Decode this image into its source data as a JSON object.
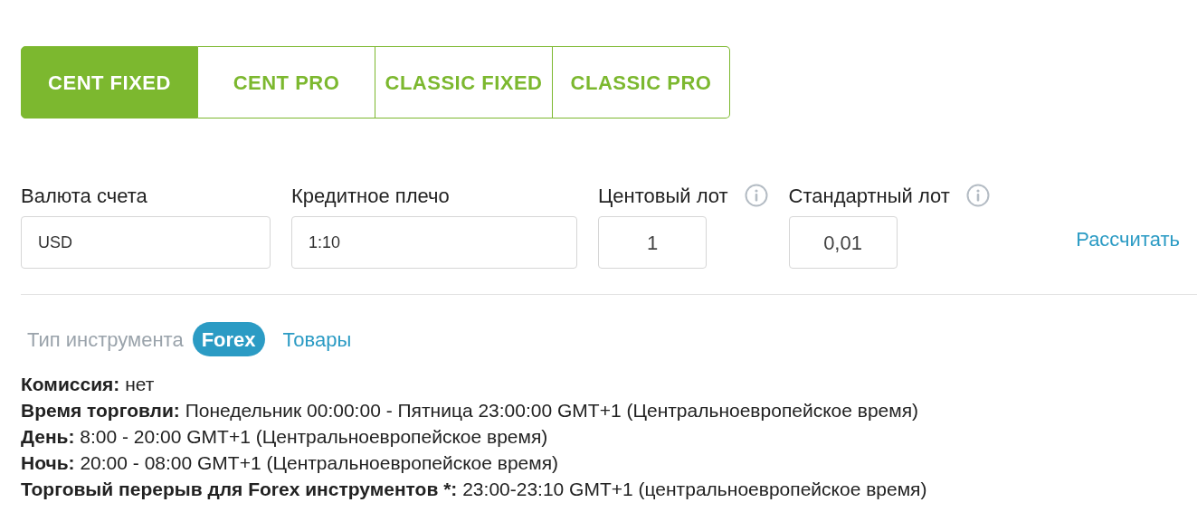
{
  "tabs": [
    {
      "label": "CENT FIXED",
      "selected": true
    },
    {
      "label": "CENT PRO",
      "selected": false
    },
    {
      "label": "CLASSIC FIXED",
      "selected": false
    },
    {
      "label": "CLASSIC PRO",
      "selected": false
    }
  ],
  "fields": [
    {
      "label": "Валюта счета",
      "value": "USD",
      "kind": "wide",
      "info": false
    },
    {
      "label": "Кредитное плечо",
      "value": "1:10",
      "kind": "wider",
      "info": false
    },
    {
      "label": "Центовый лот",
      "value": "1",
      "kind": "lot",
      "info": true
    },
    {
      "label": "Стандартный лот",
      "value": "0,01",
      "kind": "lot",
      "info": true
    }
  ],
  "calculate_link": "Рассчитать",
  "instrument_type": {
    "label": "Тип инструмента",
    "options": [
      {
        "label": "Forex",
        "selected": true
      },
      {
        "label": "Товары",
        "selected": false
      }
    ]
  },
  "info_lines": [
    "**Комиссия:** нет",
    "**Время торговли:** Понедельник 00:00:00 - Пятница 23:00:00 GMT+1 (Центральноевропейское время)",
    "**День:** 8:00 - 20:00 GMT+1 (Центральноевропейское время)",
    "**Ночь:** 20:00 - 08:00 GMT+1 (Центральноевропейское время)",
    "**Торговый перерыв для Forex инструментов *:** 23:00-23:10 GMT+1 (центральноевропейское время)"
  ]
}
